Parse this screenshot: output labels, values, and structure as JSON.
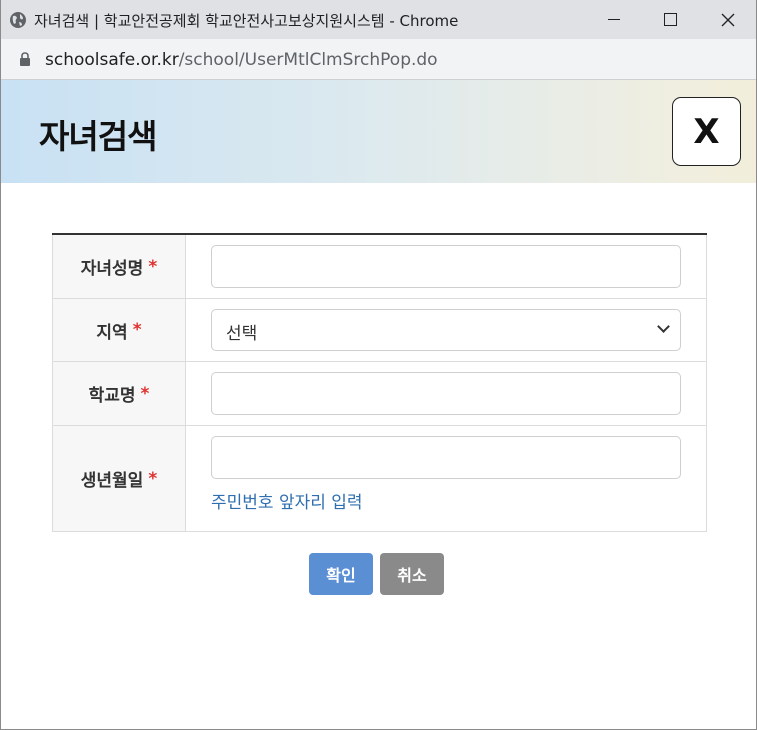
{
  "window": {
    "title": "자녀검색 | 학교안전공제회 학교안전사고보상지원시스템 - Chrome"
  },
  "address": {
    "host": "schoolsafe.or.kr",
    "path": "/school/UserMtlClmSrchPop.do"
  },
  "popup": {
    "title": "자녀검색",
    "close_label": "X"
  },
  "form": {
    "rows": [
      {
        "label": "자녀성명",
        "required": "*"
      },
      {
        "label": "지역",
        "required": "*",
        "select_value": "선택"
      },
      {
        "label": "학교명",
        "required": "*"
      },
      {
        "label": "생년월일",
        "required": "*",
        "hint": "주민번호 앞자리 입력"
      }
    ]
  },
  "buttons": {
    "ok": "확인",
    "cancel": "취소"
  }
}
